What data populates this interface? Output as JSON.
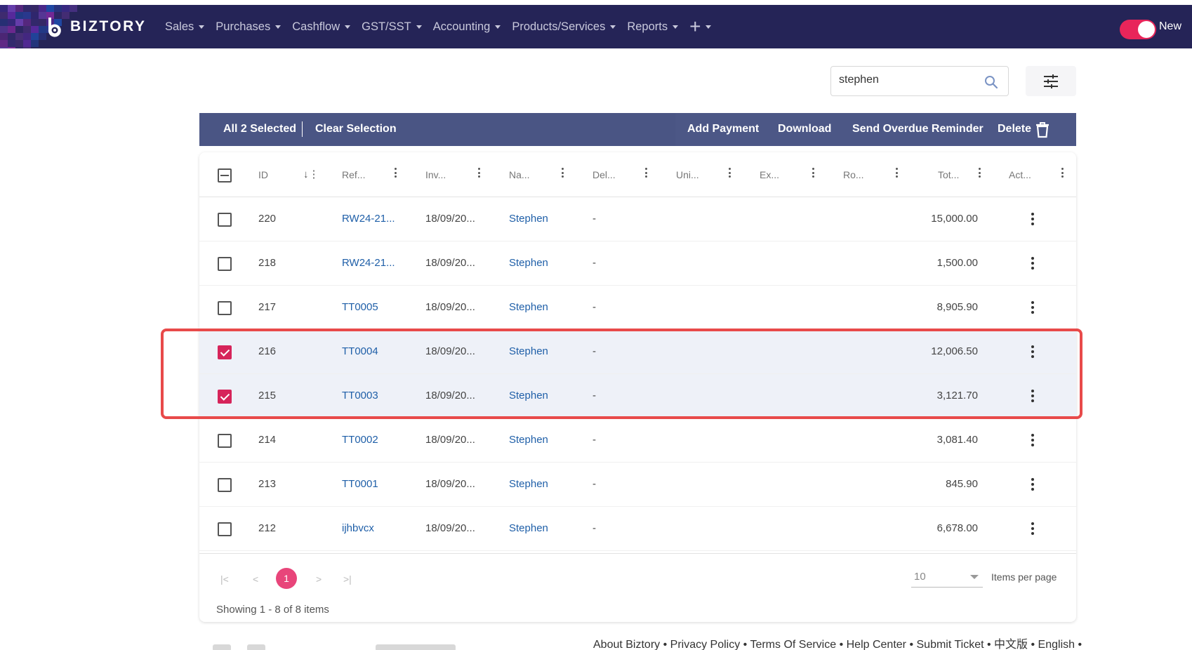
{
  "brand": {
    "name": "BIZTORY"
  },
  "nav": {
    "items": [
      {
        "label": "Sales"
      },
      {
        "label": "Purchases"
      },
      {
        "label": "Cashflow"
      },
      {
        "label": "GST/SST"
      },
      {
        "label": "Accounting"
      },
      {
        "label": "Products/Services"
      },
      {
        "label": "Reports"
      }
    ],
    "plus": "+",
    "toggle_label": "New"
  },
  "search": {
    "value": "stephen"
  },
  "selection": {
    "selected_label": "All 2 Selected",
    "clear_label": "Clear Selection",
    "actions": {
      "add_payment": "Add Payment",
      "download": "Download",
      "reminder": "Send Overdue Reminder",
      "delete": "Delete"
    }
  },
  "table": {
    "columns": {
      "id": "ID",
      "ref": "Ref...",
      "inv": "Inv...",
      "name": "Na...",
      "del": "Del...",
      "uni": "Uni...",
      "ex": "Ex...",
      "ro": "Ro...",
      "tot": "Tot...",
      "act": "Act..."
    },
    "rows": [
      {
        "id": "220",
        "ref": "RW24-21...",
        "inv": "18/09/20...",
        "name": "Stephen",
        "del": "-",
        "total": "15,000.00",
        "checked": false
      },
      {
        "id": "218",
        "ref": "RW24-21...",
        "inv": "18/09/20...",
        "name": "Stephen",
        "del": "-",
        "total": "1,500.00",
        "checked": false
      },
      {
        "id": "217",
        "ref": "TT0005",
        "inv": "18/09/20...",
        "name": "Stephen",
        "del": "-",
        "total": "8,905.90",
        "checked": false
      },
      {
        "id": "216",
        "ref": "TT0004",
        "inv": "18/09/20...",
        "name": "Stephen",
        "del": "-",
        "total": "12,006.50",
        "checked": true
      },
      {
        "id": "215",
        "ref": "TT0003",
        "inv": "18/09/20...",
        "name": "Stephen",
        "del": "-",
        "total": "3,121.70",
        "checked": true
      },
      {
        "id": "214",
        "ref": "TT0002",
        "inv": "18/09/20...",
        "name": "Stephen",
        "del": "-",
        "total": "3,081.40",
        "checked": false
      },
      {
        "id": "213",
        "ref": "TT0001",
        "inv": "18/09/20...",
        "name": "Stephen",
        "del": "-",
        "total": "845.90",
        "checked": false
      },
      {
        "id": "212",
        "ref": "ijhbvcx",
        "inv": "18/09/20...",
        "name": "Stephen",
        "del": "-",
        "total": "6,678.00",
        "checked": false
      }
    ]
  },
  "pagination": {
    "first": "|<",
    "prev": "<",
    "current": "1",
    "next": ">",
    "last": ">|",
    "per_page_value": "10",
    "per_page_label": "Items per page",
    "showing": "Showing 1 - 8 of 8 items"
  },
  "footer": {
    "links": [
      "About Biztory",
      "Privacy Policy",
      "Terms Of Service",
      "Help Center",
      "Submit Ticket",
      "中文版",
      "English"
    ],
    "separator": " • "
  },
  "colors": {
    "nav_bg": "#252457",
    "selection_bar": "#4a5584",
    "accent": "#e8255a",
    "link": "#1f5fa8",
    "highlight": "#e84a4a"
  }
}
